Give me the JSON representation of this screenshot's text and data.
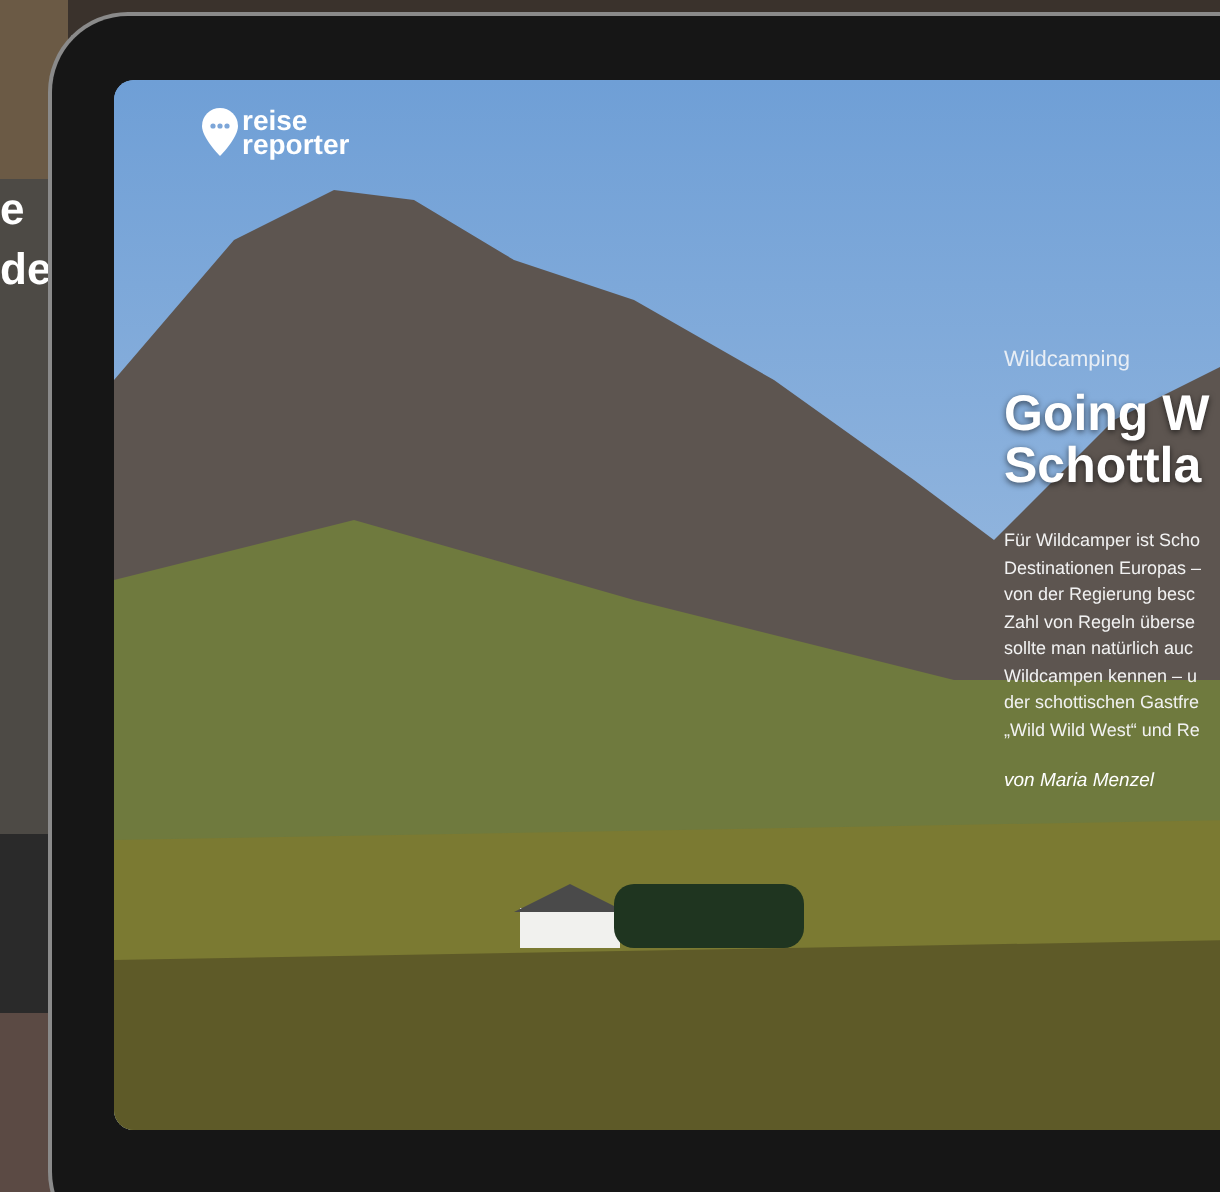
{
  "background": {
    "heading_lines": [
      "e",
      "de"
    ]
  },
  "article": {
    "logo": {
      "line_1": "reise",
      "line_2": "reporter"
    },
    "category": "Wildcamping",
    "title_lines": [
      "Going W",
      "Schottla"
    ],
    "teaser_lines": [
      "Für Wildcamper ist Scho",
      "Destinationen Europas –",
      "von der Regierung besc",
      "Zahl von Regeln überse",
      "sollte man natürlich auc",
      "Wildcampen kennen – u",
      "der schottischen Gastfre",
      "„Wild Wild West“ und Re"
    ],
    "author": "von Maria Menzel"
  }
}
